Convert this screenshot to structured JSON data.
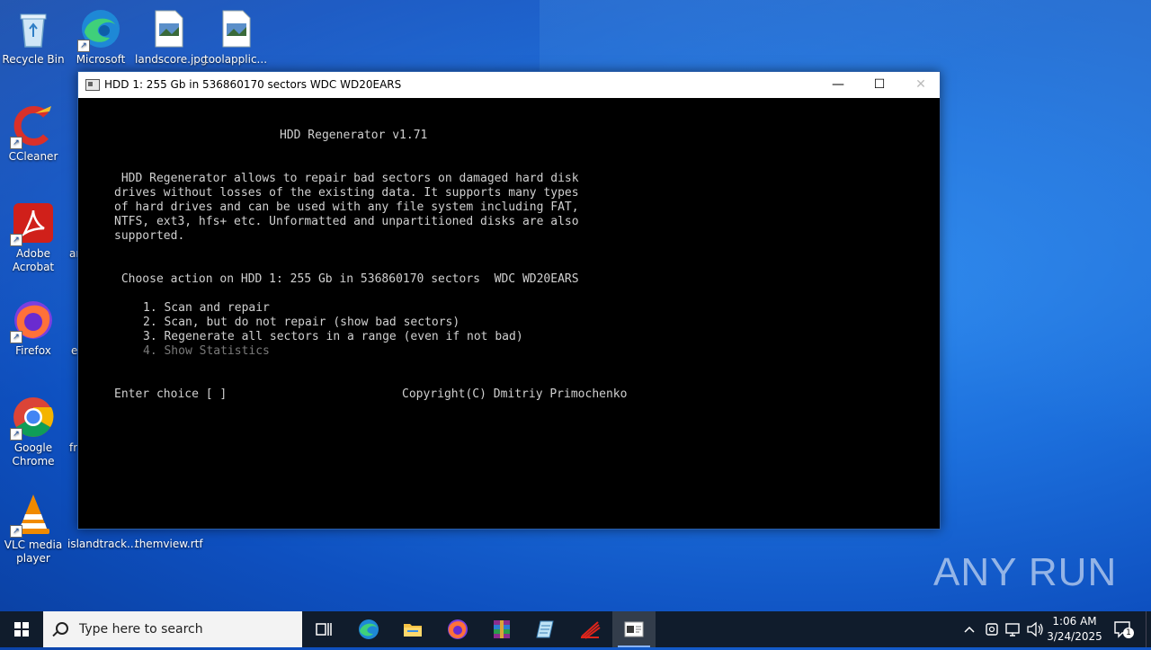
{
  "desktop": {
    "icons": [
      {
        "label": "Recycle Bin"
      },
      {
        "label": "Microsoft Edge"
      },
      {
        "label": "landscore.jpg"
      },
      {
        "label": "toolapplic..."
      },
      {
        "label": "CCleaner"
      },
      {
        "label": "Adobe Acrobat"
      },
      {
        "label": "Firefox"
      },
      {
        "label": "Google Chrome"
      },
      {
        "label": "VLC media player"
      },
      {
        "label": "islandtrack..."
      },
      {
        "label": "themview.rtf"
      }
    ],
    "partial_labels": [
      "ar",
      "e",
      "fr"
    ]
  },
  "window": {
    "title": "HDD 1: 255 Gb in 536860170 sectors  WDC WD20EARS",
    "controls": {
      "minimize": "—",
      "maximize": "☐",
      "close": "✕"
    },
    "console": {
      "heading": "HDD Regenerator v1.71",
      "description": [
        " HDD Regenerator allows to repair bad sectors on damaged hard disk",
        "drives without losses of the existing data. It supports many types",
        "of hard drives and can be used with any file system including FAT,",
        "NTFS, ext3, hfs+ etc. Unformatted and unpartitioned disks are also",
        "supported."
      ],
      "prompt_action": " Choose action on HDD 1: 255 Gb in 536860170 sectors  WDC WD20EARS",
      "options": [
        "1. Scan and repair",
        "2. Scan, but do not repair (show bad sectors)",
        "3. Regenerate all sectors in a range (even if not bad)",
        "4. Show Statistics"
      ],
      "enter_choice": "Enter choice [ ]",
      "copyright": "Copyright(C) Dmitriy Primochenko"
    }
  },
  "taskbar": {
    "search_placeholder": "Type here to search",
    "apps": [
      "task-view",
      "microsoft-edge",
      "file-explorer",
      "firefox",
      "winrar",
      "notepad-app",
      "acrobat-reader",
      "hdd-regenerator-console"
    ],
    "clock_time": "1:06 AM",
    "clock_date": "3/24/2025",
    "notification_count": "1"
  },
  "watermark": "ANY RUN",
  "colors": {
    "console_bg": "#000000",
    "console_text": "#d0d0d0",
    "disabled_text": "#7a7a7a",
    "taskbar": "#101c2c"
  }
}
